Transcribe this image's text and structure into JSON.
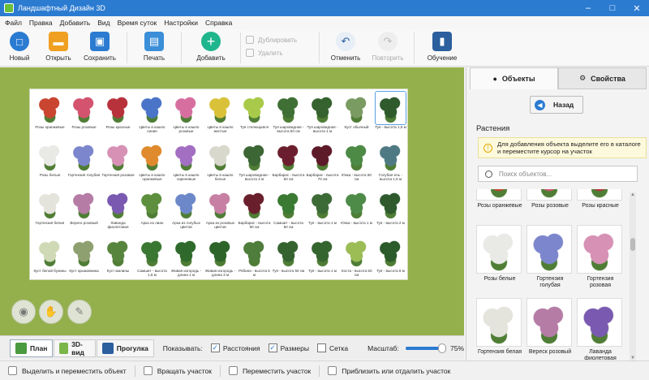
{
  "window": {
    "title": "Ландшафтный Дизайн 3D"
  },
  "menu": [
    "Файл",
    "Правка",
    "Добавить",
    "Вид",
    "Время суток",
    "Настройки",
    "Справка"
  ],
  "toolbar": {
    "new": "Новый",
    "open": "Открыть",
    "save": "Сохранить",
    "print": "Печать",
    "add": "Добавить",
    "duplicate": "Дублировать",
    "delete": "Удалить",
    "undo": "Отменить",
    "redo": "Повторить",
    "tutorial": "Обучение"
  },
  "catalog": {
    "items": [
      {
        "label": "Розы оранжевые",
        "color": "#c9452f"
      },
      {
        "label": "Розы розовые",
        "color": "#d4536e"
      },
      {
        "label": "Розы красные",
        "color": "#b8323c"
      },
      {
        "label": "Цветы в кашпо синие",
        "color": "#4a74c8"
      },
      {
        "label": "Цветы в кашпо розовые",
        "color": "#d66fa0"
      },
      {
        "label": "Цветы в кашпо желтые",
        "color": "#d9c13a"
      },
      {
        "label": "Туя стелющаяся",
        "color": "#a9c94a"
      },
      {
        "label": "Туя шаровидная - высота 50 см",
        "color": "#3f6f34"
      },
      {
        "label": "Туя шаровидная - высота 1 м",
        "color": "#35622e"
      },
      {
        "label": "Куст обычный",
        "color": "#7a9b62"
      },
      {
        "label": "Туя - высота 1,5 м",
        "color": "#2f5a2c"
      },
      {
        "label": "Розы белые",
        "color": "#e9e9e6"
      },
      {
        "label": "Гортензия голубая",
        "color": "#7c86cc"
      },
      {
        "label": "Гортензия розовая",
        "color": "#d691b4"
      },
      {
        "label": "Цветы в кашпо оранжевые",
        "color": "#e08a2e"
      },
      {
        "label": "Цветы в кашпо сиреневые",
        "color": "#a36fc2"
      },
      {
        "label": "Цветы в кашпо белые",
        "color": "#d8d8cc"
      },
      {
        "label": "Туя шаровидная - высота 2 м",
        "color": "#3c6634"
      },
      {
        "label": "Барбарис - высота 50 см",
        "color": "#6b1f2e"
      },
      {
        "label": "Барбарис - высота 70 см",
        "color": "#5d1a28"
      },
      {
        "label": "Юкка - высота 50 см",
        "color": "#4c8a46"
      },
      {
        "label": "Голубая ель - высота 1,5 м",
        "color": "#4f7a84"
      },
      {
        "label": "Гортензия белая",
        "color": "#e4e4dc"
      },
      {
        "label": "Вереск розовый",
        "color": "#b57ca6"
      },
      {
        "label": "Лаванда фиолетовая",
        "color": "#7a5ab0"
      },
      {
        "label": "Арка из лиан",
        "color": "#5d8f3e"
      },
      {
        "label": "Арка из голубых цветов",
        "color": "#6c88c9"
      },
      {
        "label": "Арка из розовых цветов",
        "color": "#c77fa3"
      },
      {
        "label": "Барбарис - высота 90 см",
        "color": "#6a1f2c"
      },
      {
        "label": "Самшит - высота 50 см",
        "color": "#3a7a33"
      },
      {
        "label": "Туя - высота 1 м",
        "color": "#3d6b38"
      },
      {
        "label": "Юкка - высота 1 м",
        "color": "#4e8b48"
      },
      {
        "label": "Туя - высота 2 м",
        "color": "#2e5a2d"
      },
      {
        "label": "Куст белой бузины",
        "color": "#cfd9b6"
      },
      {
        "label": "Куст крыжовника",
        "color": "#8fa070"
      },
      {
        "label": "Куст малины",
        "color": "#58853e"
      },
      {
        "label": "Самшит - высота 1,5 м",
        "color": "#3a7733"
      },
      {
        "label": "Живая изгородь - длина 1 м",
        "color": "#2f6a2c"
      },
      {
        "label": "Живая изгородь - длина 3 м",
        "color": "#2c6429"
      },
      {
        "label": "Рябина - высота 5 м",
        "color": "#4f7d3b"
      },
      {
        "label": "Туя - высота 50 см",
        "color": "#356330"
      },
      {
        "label": "Туя - высота 1 м",
        "color": "#35652f"
      },
      {
        "label": "Хоста - высота 50 см",
        "color": "#9cbd56"
      },
      {
        "label": "Туя - высота 6 м",
        "color": "#2b5a2b"
      }
    ]
  },
  "modes": {
    "plan": "План",
    "view3d": "3D-вид",
    "walk": "Прогулка"
  },
  "show": {
    "label": "Показывать:",
    "distances": "Расстояния",
    "distances_checked": true,
    "sizes": "Размеры",
    "sizes_checked": true,
    "grid": "Сетка",
    "grid_checked": false
  },
  "scale": {
    "label": "Масштаб:",
    "value": "75%",
    "level": 0.75
  },
  "status": [
    "Выделить и переместить объект",
    "Вращать участок",
    "Переместить участок",
    "Приблизить или отдалить участок"
  ],
  "panel": {
    "tab_objects": "Объекты",
    "tab_properties": "Свойства",
    "back": "Назад",
    "section": "Растения",
    "hint": "Для добавления объекта выделите его в каталоге и переместите курсор на участок",
    "search_placeholder": "Поиск объектов...",
    "items": [
      {
        "label": "Розы оранжевые",
        "color": "#c9452f"
      },
      {
        "label": "Розы розовые",
        "color": "#d4536e"
      },
      {
        "label": "Розы красные",
        "color": "#b8323c"
      },
      {
        "label": "Розы белые",
        "color": "#e9e9e6"
      },
      {
        "label": "Гортензия голубая",
        "color": "#7c86cc"
      },
      {
        "label": "Гортензия розовая",
        "color": "#d691b4"
      },
      {
        "label": "Гортензия белая",
        "color": "#e4e4dc"
      },
      {
        "label": "Вереск розовый",
        "color": "#b57ca6"
      },
      {
        "label": "Лаванда фиолетовая",
        "color": "#7a5ab0"
      }
    ]
  },
  "colors": {
    "accent": "#2b7bd1",
    "canvas": "#94b04c"
  }
}
